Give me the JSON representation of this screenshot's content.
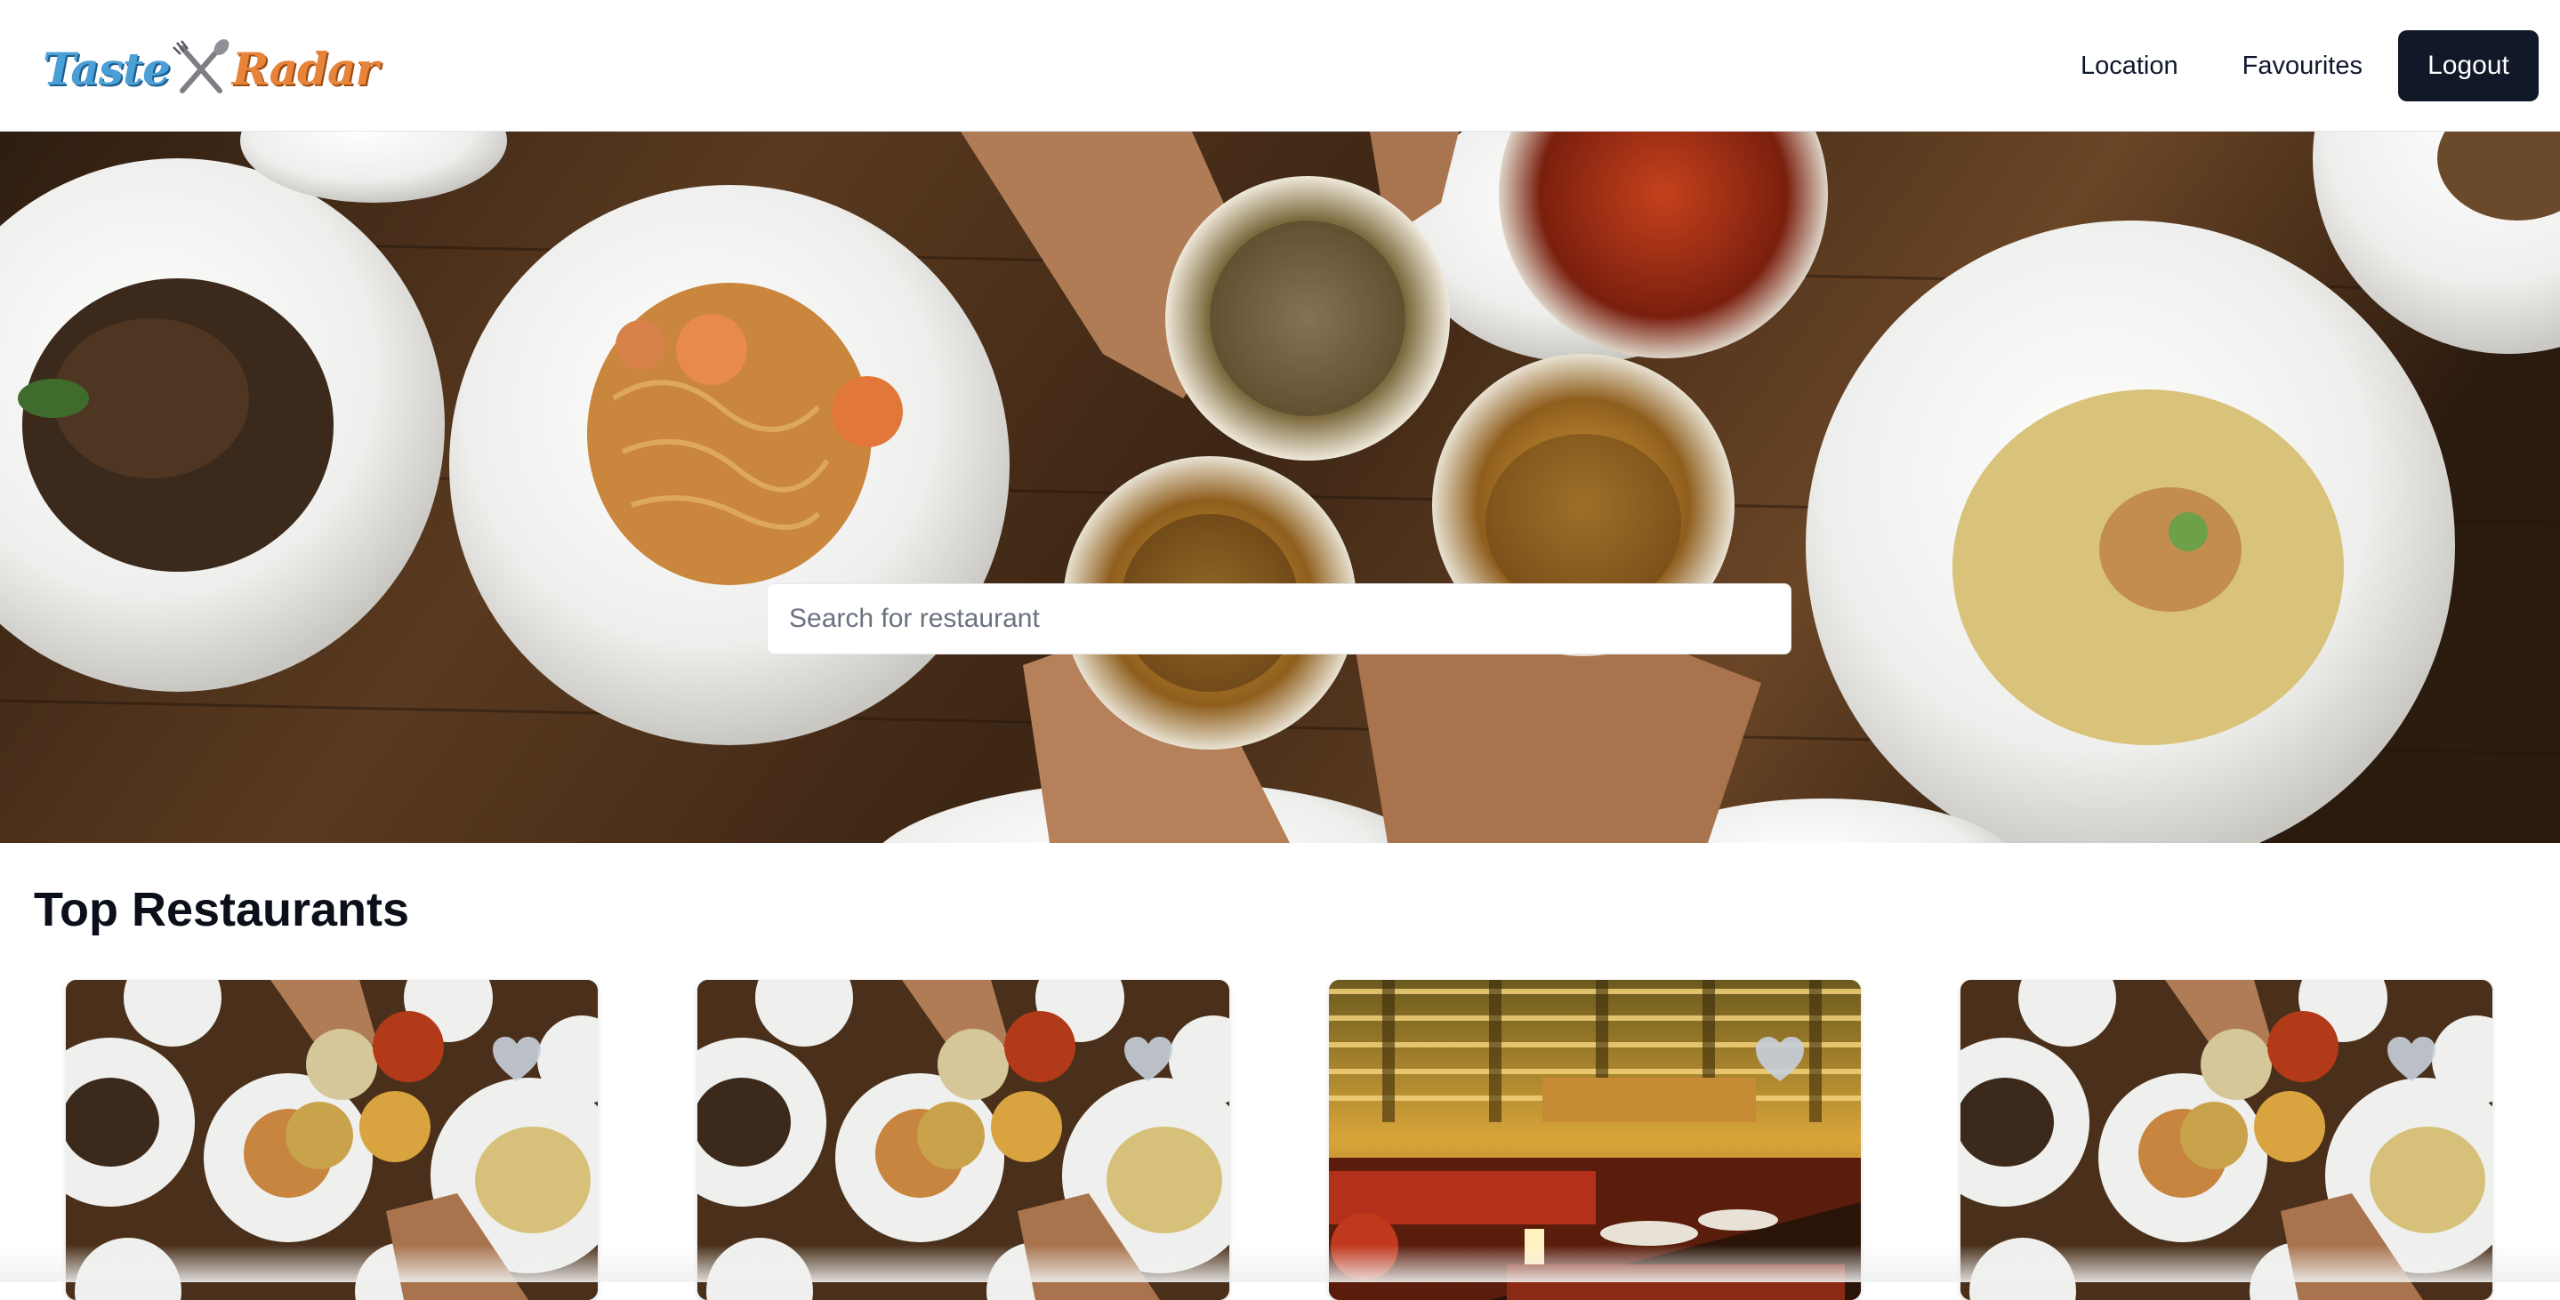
{
  "header": {
    "logo_part1": "Taste",
    "logo_part2": "Radar",
    "logo_icon": "fork-knife-icon",
    "nav": [
      {
        "label": "Location"
      },
      {
        "label": "Favourites"
      }
    ],
    "logout_label": "Logout"
  },
  "hero": {
    "search_placeholder": "Search for restaurant",
    "search_value": ""
  },
  "section": {
    "title": "Top Restaurants"
  },
  "cards": [
    {
      "image": "table-toast-photo",
      "icon": "heart-icon"
    },
    {
      "image": "table-toast-photo",
      "icon": "heart-icon"
    },
    {
      "image": "hotel-lobby-restaurant-photo",
      "icon": "heart-icon"
    },
    {
      "image": "table-toast-photo",
      "icon": "heart-icon"
    }
  ],
  "colors": {
    "logout_bg": "#111827",
    "logo_blue": "#4a9fd6",
    "logo_orange": "#e8843a"
  }
}
